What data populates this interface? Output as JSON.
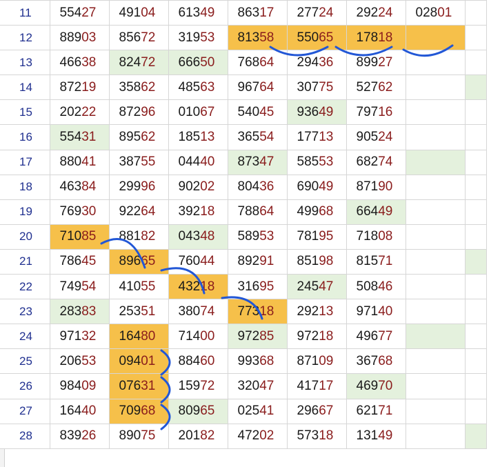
{
  "rows": [
    {
      "num": "11",
      "cells": [
        {
          "pre": "554",
          "suf": "27",
          "bg": ""
        },
        {
          "pre": "491",
          "suf": "04",
          "bg": ""
        },
        {
          "pre": "613",
          "suf": "49",
          "bg": ""
        },
        {
          "pre": "863",
          "suf": "17",
          "bg": ""
        },
        {
          "pre": "277",
          "suf": "24",
          "bg": ""
        },
        {
          "pre": "292",
          "suf": "24",
          "bg": ""
        },
        {
          "pre": "028",
          "suf": "01",
          "bg": ""
        },
        {
          "pre": "",
          "suf": "",
          "bg": ""
        }
      ]
    },
    {
      "num": "12",
      "cells": [
        {
          "pre": "889",
          "suf": "03",
          "bg": ""
        },
        {
          "pre": "856",
          "suf": "72",
          "bg": ""
        },
        {
          "pre": "319",
          "suf": "53",
          "bg": ""
        },
        {
          "pre": "813",
          "suf": "58",
          "bg": "orange"
        },
        {
          "pre": "550",
          "suf": "65",
          "bg": "orange"
        },
        {
          "pre": "178",
          "suf": "18",
          "bg": "orange"
        },
        {
          "pre": "",
          "suf": "",
          "bg": "orange"
        },
        {
          "pre": "",
          "suf": "",
          "bg": ""
        }
      ]
    },
    {
      "num": "13",
      "cells": [
        {
          "pre": "466",
          "suf": "38",
          "bg": ""
        },
        {
          "pre": "824",
          "suf": "72",
          "bg": "green"
        },
        {
          "pre": "666",
          "suf": "50",
          "bg": "green"
        },
        {
          "pre": "768",
          "suf": "64",
          "bg": ""
        },
        {
          "pre": "294",
          "suf": "36",
          "bg": ""
        },
        {
          "pre": "899",
          "suf": "27",
          "bg": ""
        },
        {
          "pre": "",
          "suf": "",
          "bg": ""
        },
        {
          "pre": "",
          "suf": "",
          "bg": ""
        }
      ]
    },
    {
      "num": "14",
      "cells": [
        {
          "pre": "872",
          "suf": "19",
          "bg": ""
        },
        {
          "pre": "358",
          "suf": "62",
          "bg": ""
        },
        {
          "pre": "485",
          "suf": "63",
          "bg": ""
        },
        {
          "pre": "967",
          "suf": "64",
          "bg": ""
        },
        {
          "pre": "307",
          "suf": "75",
          "bg": ""
        },
        {
          "pre": "527",
          "suf": "62",
          "bg": ""
        },
        {
          "pre": "",
          "suf": "",
          "bg": ""
        },
        {
          "pre": "",
          "suf": "",
          "bg": "green"
        }
      ]
    },
    {
      "num": "15",
      "cells": [
        {
          "pre": "202",
          "suf": "22",
          "bg": ""
        },
        {
          "pre": "872",
          "suf": "96",
          "bg": ""
        },
        {
          "pre": "010",
          "suf": "67",
          "bg": ""
        },
        {
          "pre": "540",
          "suf": "45",
          "bg": ""
        },
        {
          "pre": "936",
          "suf": "49",
          "bg": "green"
        },
        {
          "pre": "797",
          "suf": "16",
          "bg": ""
        },
        {
          "pre": "",
          "suf": "",
          "bg": ""
        },
        {
          "pre": "",
          "suf": "",
          "bg": ""
        }
      ]
    },
    {
      "num": "16",
      "cells": [
        {
          "pre": "554",
          "suf": "31",
          "bg": "green"
        },
        {
          "pre": "895",
          "suf": "62",
          "bg": ""
        },
        {
          "pre": "185",
          "suf": "13",
          "bg": ""
        },
        {
          "pre": "365",
          "suf": "54",
          "bg": ""
        },
        {
          "pre": "177",
          "suf": "13",
          "bg": ""
        },
        {
          "pre": "905",
          "suf": "24",
          "bg": ""
        },
        {
          "pre": "",
          "suf": "",
          "bg": ""
        },
        {
          "pre": "",
          "suf": "",
          "bg": ""
        }
      ]
    },
    {
      "num": "17",
      "cells": [
        {
          "pre": "880",
          "suf": "41",
          "bg": ""
        },
        {
          "pre": "387",
          "suf": "55",
          "bg": ""
        },
        {
          "pre": "044",
          "suf": "40",
          "bg": ""
        },
        {
          "pre": "873",
          "suf": "47",
          "bg": "green"
        },
        {
          "pre": "585",
          "suf": "53",
          "bg": ""
        },
        {
          "pre": "682",
          "suf": "74",
          "bg": ""
        },
        {
          "pre": "",
          "suf": "",
          "bg": "green"
        },
        {
          "pre": "",
          "suf": "",
          "bg": ""
        }
      ]
    },
    {
      "num": "18",
      "cells": [
        {
          "pre": "463",
          "suf": "84",
          "bg": ""
        },
        {
          "pre": "299",
          "suf": "96",
          "bg": ""
        },
        {
          "pre": "902",
          "suf": "02",
          "bg": ""
        },
        {
          "pre": "804",
          "suf": "36",
          "bg": ""
        },
        {
          "pre": "690",
          "suf": "49",
          "bg": ""
        },
        {
          "pre": "871",
          "suf": "90",
          "bg": ""
        },
        {
          "pre": "",
          "suf": "",
          "bg": ""
        },
        {
          "pre": "",
          "suf": "",
          "bg": ""
        }
      ]
    },
    {
      "num": "19",
      "cells": [
        {
          "pre": "769",
          "suf": "30",
          "bg": ""
        },
        {
          "pre": "922",
          "suf": "64",
          "bg": ""
        },
        {
          "pre": "392",
          "suf": "18",
          "bg": ""
        },
        {
          "pre": "788",
          "suf": "64",
          "bg": ""
        },
        {
          "pre": "499",
          "suf": "68",
          "bg": ""
        },
        {
          "pre": "664",
          "suf": "49",
          "bg": "green"
        },
        {
          "pre": "",
          "suf": "",
          "bg": ""
        },
        {
          "pre": "",
          "suf": "",
          "bg": ""
        }
      ]
    },
    {
      "num": "20",
      "cells": [
        {
          "pre": "710",
          "suf": "85",
          "bg": "orange"
        },
        {
          "pre": "881",
          "suf": "82",
          "bg": ""
        },
        {
          "pre": "043",
          "suf": "48",
          "bg": "green"
        },
        {
          "pre": "589",
          "suf": "53",
          "bg": ""
        },
        {
          "pre": "781",
          "suf": "95",
          "bg": ""
        },
        {
          "pre": "718",
          "suf": "08",
          "bg": ""
        },
        {
          "pre": "",
          "suf": "",
          "bg": ""
        },
        {
          "pre": "",
          "suf": "",
          "bg": ""
        }
      ]
    },
    {
      "num": "21",
      "cells": [
        {
          "pre": "786",
          "suf": "45",
          "bg": ""
        },
        {
          "pre": "896",
          "suf": "65",
          "bg": "orange"
        },
        {
          "pre": "760",
          "suf": "44",
          "bg": ""
        },
        {
          "pre": "892",
          "suf": "91",
          "bg": ""
        },
        {
          "pre": "851",
          "suf": "98",
          "bg": ""
        },
        {
          "pre": "815",
          "suf": "71",
          "bg": ""
        },
        {
          "pre": "",
          "suf": "",
          "bg": ""
        },
        {
          "pre": "",
          "suf": "",
          "bg": "green"
        }
      ]
    },
    {
      "num": "22",
      "cells": [
        {
          "pre": "749",
          "suf": "54",
          "bg": ""
        },
        {
          "pre": "410",
          "suf": "55",
          "bg": ""
        },
        {
          "pre": "432",
          "suf": "18",
          "bg": "orange"
        },
        {
          "pre": "316",
          "suf": "95",
          "bg": ""
        },
        {
          "pre": "245",
          "suf": "47",
          "bg": "green"
        },
        {
          "pre": "508",
          "suf": "46",
          "bg": ""
        },
        {
          "pre": "",
          "suf": "",
          "bg": ""
        },
        {
          "pre": "",
          "suf": "",
          "bg": ""
        }
      ]
    },
    {
      "num": "23",
      "cells": [
        {
          "pre": "283",
          "suf": "83",
          "bg": "green"
        },
        {
          "pre": "253",
          "suf": "51",
          "bg": ""
        },
        {
          "pre": "380",
          "suf": "74",
          "bg": ""
        },
        {
          "pre": "773",
          "suf": "18",
          "bg": "orange"
        },
        {
          "pre": "292",
          "suf": "13",
          "bg": ""
        },
        {
          "pre": "971",
          "suf": "40",
          "bg": ""
        },
        {
          "pre": "",
          "suf": "",
          "bg": ""
        },
        {
          "pre": "",
          "suf": "",
          "bg": ""
        }
      ]
    },
    {
      "num": "24",
      "cells": [
        {
          "pre": "971",
          "suf": "32",
          "bg": ""
        },
        {
          "pre": "164",
          "suf": "80",
          "bg": "orange"
        },
        {
          "pre": "714",
          "suf": "00",
          "bg": ""
        },
        {
          "pre": "972",
          "suf": "85",
          "bg": "green"
        },
        {
          "pre": "972",
          "suf": "18",
          "bg": ""
        },
        {
          "pre": "496",
          "suf": "77",
          "bg": ""
        },
        {
          "pre": "",
          "suf": "",
          "bg": "green"
        },
        {
          "pre": "",
          "suf": "",
          "bg": ""
        }
      ]
    },
    {
      "num": "25",
      "cells": [
        {
          "pre": "206",
          "suf": "53",
          "bg": ""
        },
        {
          "pre": "094",
          "suf": "01",
          "bg": "orange"
        },
        {
          "pre": "884",
          "suf": "60",
          "bg": ""
        },
        {
          "pre": "993",
          "suf": "68",
          "bg": ""
        },
        {
          "pre": "871",
          "suf": "09",
          "bg": ""
        },
        {
          "pre": "367",
          "suf": "68",
          "bg": ""
        },
        {
          "pre": "",
          "suf": "",
          "bg": ""
        },
        {
          "pre": "",
          "suf": "",
          "bg": ""
        }
      ]
    },
    {
      "num": "26",
      "cells": [
        {
          "pre": "984",
          "suf": "09",
          "bg": ""
        },
        {
          "pre": "076",
          "suf": "31",
          "bg": "orange"
        },
        {
          "pre": "159",
          "suf": "72",
          "bg": ""
        },
        {
          "pre": "320",
          "suf": "47",
          "bg": ""
        },
        {
          "pre": "417",
          "suf": "17",
          "bg": ""
        },
        {
          "pre": "469",
          "suf": "70",
          "bg": "green"
        },
        {
          "pre": "",
          "suf": "",
          "bg": ""
        },
        {
          "pre": "",
          "suf": "",
          "bg": ""
        }
      ]
    },
    {
      "num": "27",
      "cells": [
        {
          "pre": "164",
          "suf": "40",
          "bg": ""
        },
        {
          "pre": "709",
          "suf": "68",
          "bg": "orange"
        },
        {
          "pre": "809",
          "suf": "65",
          "bg": "green"
        },
        {
          "pre": "025",
          "suf": "41",
          "bg": ""
        },
        {
          "pre": "296",
          "suf": "67",
          "bg": ""
        },
        {
          "pre": "621",
          "suf": "71",
          "bg": ""
        },
        {
          "pre": "",
          "suf": "",
          "bg": ""
        },
        {
          "pre": "",
          "suf": "",
          "bg": ""
        }
      ]
    },
    {
      "num": "28",
      "cells": [
        {
          "pre": "839",
          "suf": "26",
          "bg": ""
        },
        {
          "pre": "890",
          "suf": "75",
          "bg": ""
        },
        {
          "pre": "201",
          "suf": "82",
          "bg": ""
        },
        {
          "pre": "472",
          "suf": "02",
          "bg": ""
        },
        {
          "pre": "573",
          "suf": "18",
          "bg": ""
        },
        {
          "pre": "131",
          "suf": "49",
          "bg": ""
        },
        {
          "pre": "",
          "suf": "",
          "bg": ""
        },
        {
          "pre": "",
          "suf": "",
          "bg": "green"
        }
      ]
    }
  ],
  "colors": {
    "highlight_orange": "#f6c04a",
    "highlight_green": "#e4f1dd",
    "digit_suffix": "#8a1c1c",
    "row_number": "#1f2f8f",
    "annotation_stroke": "#2257d6"
  }
}
